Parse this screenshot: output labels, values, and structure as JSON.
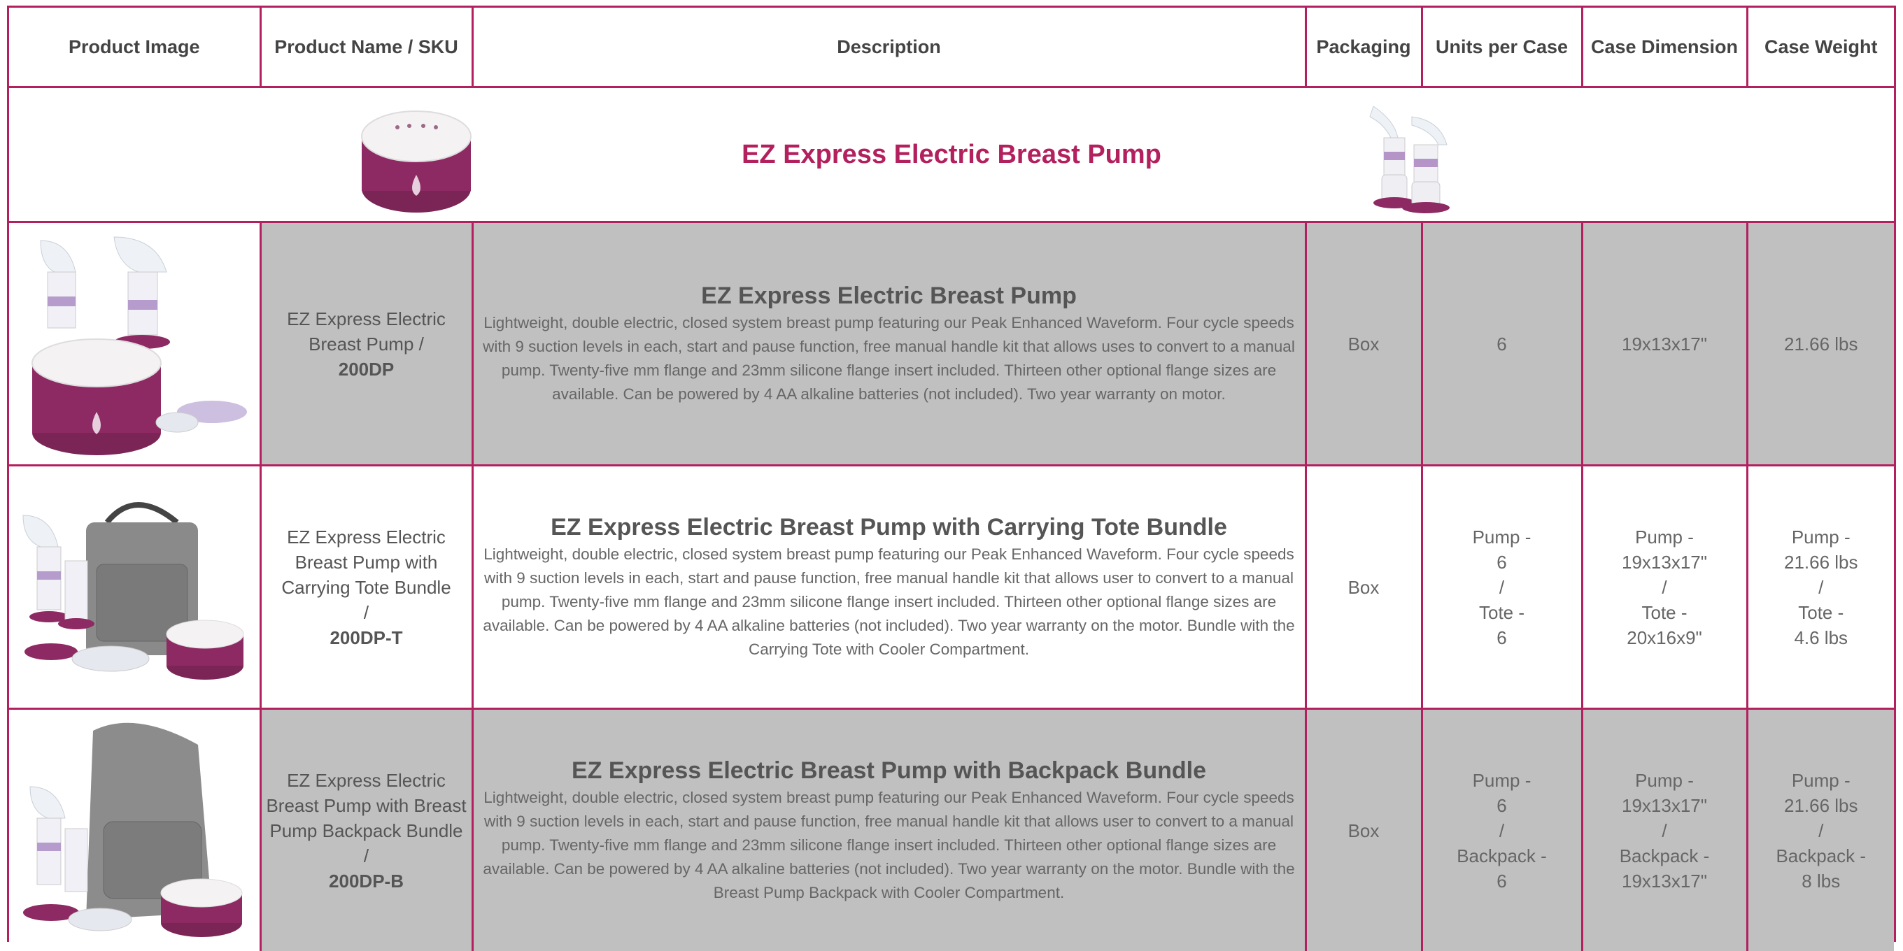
{
  "headers": {
    "image": "Product Image",
    "name": "Product Name / SKU",
    "description": "Description",
    "packaging": "Packaging",
    "units": "Units per Case",
    "dimension": "Case Dimension",
    "weight": "Case Weight"
  },
  "banner": {
    "title": "EZ Express Electric Breast Pump"
  },
  "products": [
    {
      "name": "EZ Express Electric Breast Pump /",
      "sku": "200DP",
      "title": "EZ Express Electric Breast Pump",
      "description": "Lightweight, double electric, closed system breast pump featuring our Peak Enhanced Waveform. Four cycle speeds with 9 suction levels in each, start and pause function, free manual handle kit that allows uses to convert to a manual pump. Twenty-five mm flange and 23mm silicone flange insert included. Thirteen other optional flange sizes are available. Can be powered by 4 AA alkaline batteries (not included). Two year warranty on motor.",
      "packaging": "Box",
      "units": [
        "6"
      ],
      "dimension": [
        "19x13x17\""
      ],
      "weight": [
        "21.66 lbs"
      ]
    },
    {
      "name": "EZ Express Electric Breast Pump with Carrying Tote Bundle",
      "sep": "/",
      "sku": "200DP-T",
      "title": "EZ Express Electric Breast Pump with Carrying Tote Bundle",
      "description": "Lightweight, double electric, closed system breast pump featuring our Peak Enhanced Waveform. Four cycle speeds with 9 suction levels in each, start and pause function, free manual handle kit that allows user to convert to a manual pump. Twenty-five mm flange and 23mm silicone flange insert included. Thirteen other optional flange sizes are available. Can be powered by 4 AA alkaline batteries (not included). Two year warranty on the motor. Bundle with the Carrying Tote with Cooler Compartment.",
      "packaging": "Box",
      "units": [
        "Pump -",
        "6",
        "/",
        "Tote -",
        "6"
      ],
      "dimension": [
        "Pump -",
        "19x13x17\"",
        "/",
        "Tote -",
        "20x16x9\""
      ],
      "weight": [
        "Pump -",
        "21.66 lbs",
        "/",
        "Tote -",
        "4.6 lbs"
      ]
    },
    {
      "name": "EZ Express Electric Breast Pump with Breast Pump Backpack Bundle /",
      "sku": "200DP-B",
      "title": "EZ Express Electric Breast Pump with Backpack Bundle",
      "description": "Lightweight, double electric, closed system breast pump featuring our Peak Enhanced Waveform. Four cycle speeds with 9 suction levels in each, start and pause function, free manual handle kit that allows user to convert to a manual pump. Twenty-five mm flange and 23mm silicone flange insert included. Thirteen other optional flange sizes are available. Can be powered by 4 AA alkaline batteries (not included). Two year warranty on the motor. Bundle with the Breast Pump Backpack with Cooler Compartment.",
      "packaging": "Box",
      "units": [
        "Pump -",
        "6",
        "/",
        "Backpack -",
        "6"
      ],
      "dimension": [
        "Pump -",
        "19x13x17\"",
        "/",
        "Backpack -",
        "19x13x17\""
      ],
      "weight": [
        "Pump -",
        "21.66 lbs",
        "/",
        "Backpack -",
        "8 lbs"
      ]
    }
  ],
  "colors": {
    "border": "#b3205e",
    "accent": "#b3205e",
    "gray_row": "#c0c0c0",
    "product_purple": "#8e2a63"
  }
}
